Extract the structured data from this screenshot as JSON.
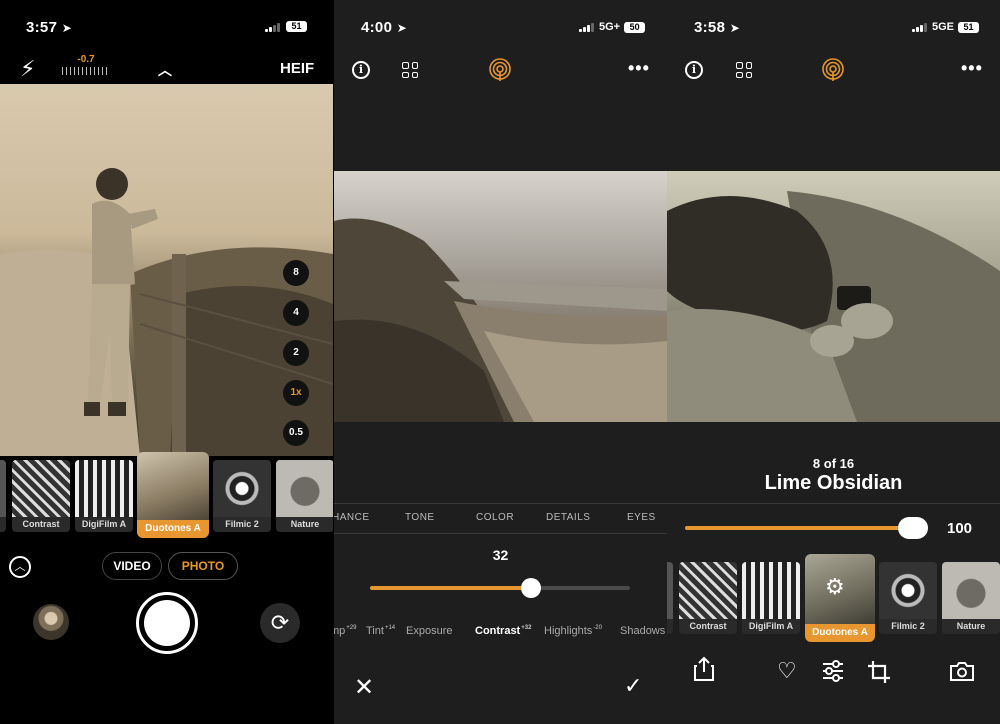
{
  "panel1": {
    "status": {
      "time": "3:57",
      "battery": "51"
    },
    "exposure_value": "-0.7",
    "format_label": "HEIF",
    "zoom_levels": [
      "8",
      "4",
      "2",
      "1x",
      "0.5"
    ],
    "filters": [
      {
        "name": "Contrast"
      },
      {
        "name": "DigiFilm A"
      },
      {
        "name": "Duotones A"
      },
      {
        "name": "Filmic 2"
      },
      {
        "name": "Nature"
      }
    ],
    "modes": {
      "video": "VIDEO",
      "photo": "PHOTO"
    }
  },
  "panel2": {
    "status": {
      "time": "4:00",
      "network": "5G+",
      "battery": "50"
    },
    "tabs": [
      "HANCE",
      "TONE",
      "COLOR",
      "DETAILS",
      "EYES"
    ],
    "slider_value": "32",
    "slider_fraction": 0.62,
    "adjustments": [
      {
        "name": "mp",
        "delta": "+29"
      },
      {
        "name": "Tint",
        "delta": "+14"
      },
      {
        "name": "Exposure",
        "delta": ""
      },
      {
        "name": "Contrast",
        "delta": "+32"
      },
      {
        "name": "Highlights",
        "delta": "-20"
      },
      {
        "name": "Shadows",
        "delta": ""
      }
    ]
  },
  "panel3": {
    "status": {
      "time": "3:58",
      "network": "5GE",
      "battery": "51"
    },
    "counter": "8 of 16",
    "preset_title": "Lime Obsidian",
    "strength_value": "100",
    "strength_fraction": 1.0,
    "filters": [
      {
        "name": "Contrast"
      },
      {
        "name": "DigiFilm A"
      },
      {
        "name": "Duotones A"
      },
      {
        "name": "Filmic 2"
      },
      {
        "name": "Nature"
      }
    ]
  },
  "colors": {
    "accent": "#e8962f",
    "panel_bg": "#1e1e1e"
  }
}
